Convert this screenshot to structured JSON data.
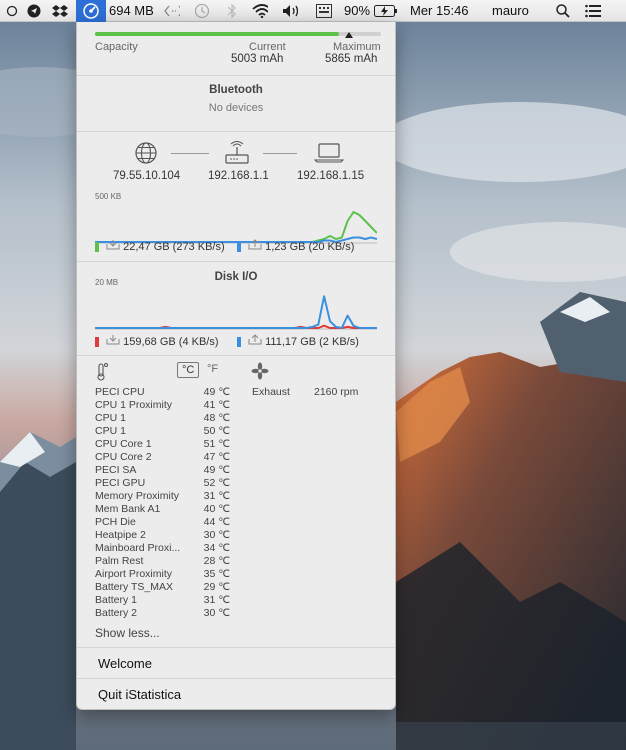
{
  "menubar": {
    "memory_label": "694 MB",
    "battery_percent": "90%",
    "clock": "Mer 15:46",
    "user": "mauro",
    "icons": [
      "circle-icon",
      "send-icon",
      "dropbox-icon",
      "istatistica-icon",
      "code-brackets-icon",
      "time-machine-icon",
      "bluetooth-icon",
      "wifi-icon",
      "volume-icon",
      "keyboard-input-icon",
      "battery-charging-icon",
      "spotlight-search-icon",
      "notification-list-icon"
    ]
  },
  "battery": {
    "capacity_label": "Capacity",
    "current_label": "Current",
    "current_value": "5003 mAh",
    "maximum_label": "Maximum",
    "maximum_value": "5865 mAh",
    "fill_fraction": 0.853
  },
  "bluetooth": {
    "title": "Bluetooth",
    "status": "No devices"
  },
  "network": {
    "public_ip": "79.55.10.104",
    "router_ip": "192.168.1.1",
    "local_ip": "192.168.1.15",
    "scale_label": "500 KB",
    "download": "22,47 GB (273 KB/s)",
    "upload": "1,23 GB (20 KB/s)",
    "download_color": "#5cc24a",
    "upload_color": "#3b8fe0",
    "download_series": [
      0,
      0,
      0,
      0,
      0,
      0,
      0,
      0,
      0,
      0,
      0,
      0,
      0,
      0,
      0,
      0,
      0,
      0,
      0,
      0,
      0,
      0,
      0,
      0,
      0,
      0,
      0,
      0,
      0,
      0,
      0,
      0,
      0,
      0,
      0,
      0,
      0,
      0,
      1,
      2,
      4,
      2,
      3,
      14,
      20,
      18,
      14,
      10,
      6
    ],
    "upload_series": [
      0,
      0,
      0,
      0,
      0,
      0,
      0,
      0,
      0,
      0,
      0,
      0,
      0,
      0,
      0,
      0,
      0,
      0,
      0,
      0,
      0,
      0,
      0,
      0,
      0,
      0,
      0,
      0,
      0,
      0,
      0,
      0,
      0,
      0,
      0,
      0,
      0,
      0,
      0,
      1,
      1,
      0,
      1,
      2,
      3,
      3,
      2,
      3,
      2
    ]
  },
  "disk": {
    "title": "Disk I/O",
    "scale_label": "20 MB",
    "read": "159,68 GB (4 KB/s)",
    "write": "111,17 GB (2 KB/s)",
    "read_color": "#e03b3b",
    "write_color": "#3b8fe0",
    "read_series": [
      0,
      0,
      0,
      0,
      0,
      0,
      0,
      0,
      0,
      0,
      0,
      0,
      1,
      0,
      0,
      0,
      0,
      0,
      0,
      0,
      0,
      0,
      0,
      0,
      0,
      0,
      0,
      0,
      0,
      0,
      0,
      0,
      0,
      0,
      0,
      1,
      0,
      0,
      0,
      2,
      0,
      0,
      0,
      1,
      0,
      0,
      0,
      0,
      0
    ],
    "write_series": [
      0,
      0,
      0,
      0,
      0,
      0,
      0,
      0,
      0,
      0,
      0,
      0,
      0,
      0,
      0,
      0,
      0,
      0,
      0,
      0,
      0,
      0,
      0,
      0,
      0,
      0,
      0,
      0,
      0,
      0,
      0,
      0,
      0,
      0,
      0,
      0,
      0,
      1,
      3,
      28,
      6,
      1,
      0,
      11,
      2,
      0,
      0,
      0,
      0
    ]
  },
  "sensors": {
    "unit_c": "°C",
    "unit_f": "°F",
    "fan_name": "Exhaust",
    "fan_speed": "2160 rpm",
    "temps": [
      {
        "name": "PECI CPU",
        "value": "49 ℃"
      },
      {
        "name": "CPU 1 Proximity",
        "value": "41 ℃"
      },
      {
        "name": "CPU 1",
        "value": "48 ℃"
      },
      {
        "name": "CPU 1",
        "value": "50 ℃"
      },
      {
        "name": "CPU Core 1",
        "value": "51 ℃"
      },
      {
        "name": "CPU Core 2",
        "value": "47 ℃"
      },
      {
        "name": "PECI SA",
        "value": "49 ℃"
      },
      {
        "name": "PECI GPU",
        "value": "52 ℃"
      },
      {
        "name": "Memory Proximity",
        "value": "31 ℃"
      },
      {
        "name": "Mem Bank A1",
        "value": "40 ℃"
      },
      {
        "name": "PCH Die",
        "value": "44 ℃"
      },
      {
        "name": "Heatpipe 2",
        "value": "30 ℃"
      },
      {
        "name": "Mainboard Proxi...",
        "value": "34 ℃"
      },
      {
        "name": "Palm Rest",
        "value": "28 ℃"
      },
      {
        "name": "Airport Proximity",
        "value": "35 ℃"
      },
      {
        "name": "Battery TS_MAX",
        "value": "29 ℃"
      },
      {
        "name": "Battery 1",
        "value": "31 ℃"
      },
      {
        "name": "Battery 2",
        "value": "30 ℃"
      }
    ],
    "show_less": "Show less..."
  },
  "menu": {
    "welcome": "Welcome",
    "quit": "Quit iStatistica"
  }
}
